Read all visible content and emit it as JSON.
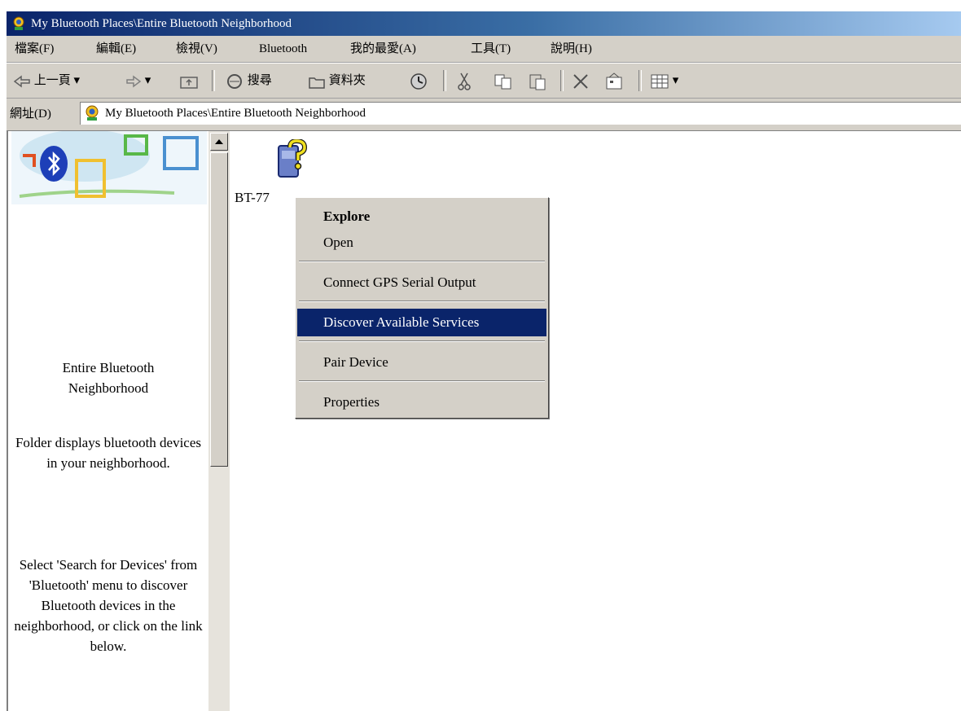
{
  "window": {
    "title": "My Bluetooth Places\\Entire Bluetooth Neighborhood"
  },
  "menubar": {
    "items": [
      {
        "label": "檔案(F)"
      },
      {
        "label": "編輯(E)"
      },
      {
        "label": "檢視(V)"
      },
      {
        "label": "Bluetooth"
      },
      {
        "label": "我的最愛(A)"
      },
      {
        "label": "工具(T)"
      },
      {
        "label": "說明(H)"
      }
    ]
  },
  "toolbar": {
    "back_label": "上一頁",
    "search_label": "搜尋",
    "folders_label": "資料夾"
  },
  "address": {
    "label": "網址(D)",
    "value": "My Bluetooth Places\\Entire Bluetooth Neighborhood"
  },
  "left_pane": {
    "title": "Entire Bluetooth Neighborhood",
    "description": "Folder displays bluetooth devices in your neighborhood.",
    "instructions": "Select 'Search for Devices' from 'Bluetooth' menu to discover Bluetooth devices in the neighborhood, or click on the link below."
  },
  "device": {
    "label": "BT-77"
  },
  "context_menu": {
    "items": [
      {
        "label": "Explore"
      },
      {
        "label": "Open"
      },
      {
        "label": "Connect GPS Serial Output"
      },
      {
        "label": "Discover Available Services"
      },
      {
        "label": "Pair Device"
      },
      {
        "label": "Properties"
      }
    ],
    "highlight_color": "#0a246a"
  },
  "icons": [
    "bluetooth-places-icon",
    "back-arrow-icon",
    "forward-arrow-icon",
    "up-folder-icon",
    "search-icon",
    "folders-icon",
    "history-icon",
    "cut-icon",
    "copy-icon",
    "paste-icon",
    "delete-icon",
    "properties-icon",
    "views-icon",
    "bluetooth-logo-icon",
    "unknown-device-icon"
  ]
}
